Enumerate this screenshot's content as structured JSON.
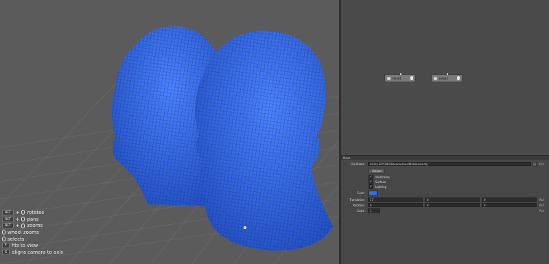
{
  "node_graph": {
    "nodes": [
      {
        "label": "Head1"
      },
      {
        "label": "Head2"
      }
    ]
  },
  "panel": {
    "title": "Mesh"
  },
  "properties": {
    "file_name_label": "File Name",
    "file_name_value": "$GALLERY:28V/Basemeshes/MaleHead.obj",
    "reset_label": "Rst",
    "reload_label": "Reload",
    "checkboxes": [
      {
        "label": "Wireframe",
        "checked": true
      },
      {
        "label": "Surface",
        "checked": true
      },
      {
        "label": "Lighting",
        "checked": true
      }
    ],
    "color_label": "Color",
    "color_value": "#3a6ee8",
    "translation_label": "Translation",
    "translation_values": [
      "17",
      "0",
      "0"
    ],
    "rotation_label": "Rotation",
    "rotation_values": [
      "0",
      "0",
      "0"
    ],
    "scale_label": "Scale",
    "scale_value": "1"
  },
  "help": [
    {
      "keys": [
        "ALT"
      ],
      "mouse": true,
      "text": "rotates"
    },
    {
      "keys": [
        "ALT"
      ],
      "mouse": true,
      "text": "pans"
    },
    {
      "keys": [
        "ALT"
      ],
      "mouse": true,
      "text": "zooms"
    },
    {
      "keys": [],
      "mouse": true,
      "text": "wheel zooms"
    },
    {
      "keys": [],
      "mouse": true,
      "text": "selects"
    },
    {
      "keys": [
        "F"
      ],
      "mouse": false,
      "text": "fits to view"
    },
    {
      "keys": [
        "S"
      ],
      "mouse": false,
      "text": "aligns camera to axis"
    }
  ],
  "colors": {
    "mesh": "#3a6ee8",
    "viewport_bg": "#5b5b5b"
  }
}
